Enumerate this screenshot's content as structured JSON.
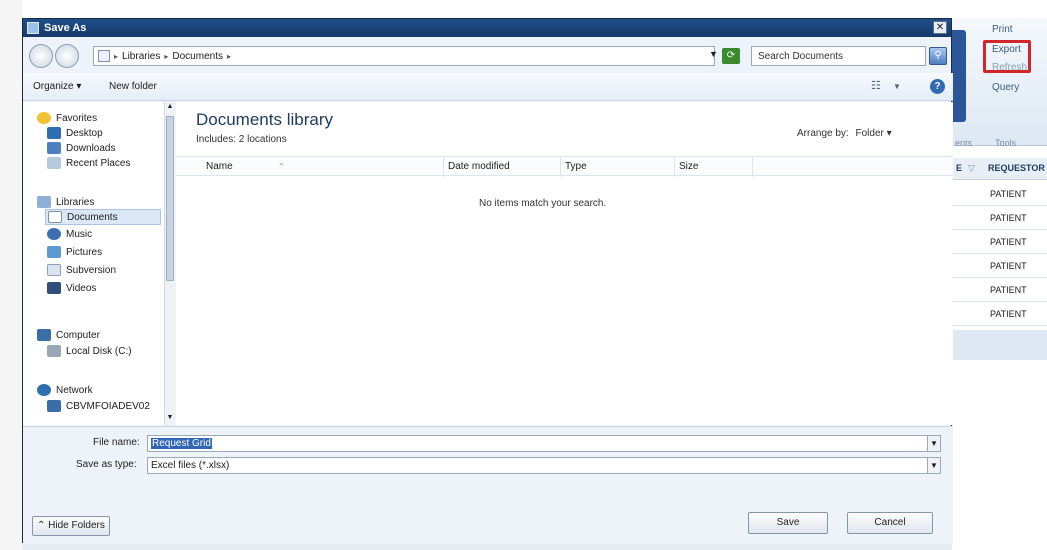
{
  "background_app": {
    "ribbon": {
      "print": "Print",
      "export": "Export",
      "refresh": "Refresh",
      "query": "Query",
      "group_left": "ents",
      "group_tools": "Tools"
    },
    "grid": {
      "header_right": "REQUESTOR",
      "header_prev": "E",
      "rows": [
        "PATIENT",
        "PATIENT",
        "PATIENT",
        "PATIENT",
        "PATIENT",
        "PATIENT"
      ]
    },
    "highlight_color": "#d0262b"
  },
  "dialog": {
    "title": "Save As",
    "close": "✕",
    "address": {
      "root_arrow": "▸",
      "parts": [
        "Libraries",
        "Documents"
      ]
    },
    "search": {
      "placeholder": "Search Documents"
    },
    "toolbar": {
      "organize": "Organize ▾",
      "new_folder": "New folder",
      "help": "?"
    },
    "nav": {
      "favorites": "Favorites",
      "desktop": "Desktop",
      "downloads": "Downloads",
      "recent": "Recent Places",
      "libraries": "Libraries",
      "documents": "Documents",
      "music": "Music",
      "pictures": "Pictures",
      "subversion": "Subversion",
      "videos": "Videos",
      "computer": "Computer",
      "local_disk": "Local Disk (C:)",
      "network": "Network",
      "network_host": "CBVMFOIADEV02"
    },
    "library": {
      "title": "Documents library",
      "includes": "Includes: 2 locations",
      "arrange_by": "Arrange by:",
      "arrange_value": "Folder ▾",
      "columns": [
        "Name",
        "Date modified",
        "Type",
        "Size"
      ],
      "empty_message": "No items match your search."
    },
    "file_name_label": "File name:",
    "file_name_value": "Request Grid",
    "save_type_label": "Save as type:",
    "save_type_value": "Excel files (*.xlsx)",
    "hide_folders": "Hide Folders",
    "save": "Save",
    "cancel": "Cancel"
  }
}
